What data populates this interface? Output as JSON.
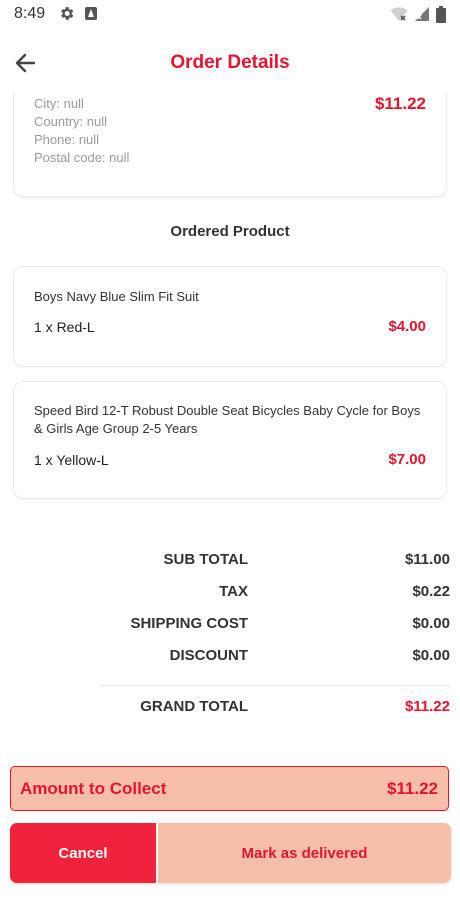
{
  "status_bar": {
    "time": "8:49",
    "icons": [
      "gear-icon",
      "a-icon",
      "wifi-icon",
      "signal-icon",
      "battery-icon"
    ]
  },
  "app_bar": {
    "title": "Order Details",
    "back_icon": "arrow-left-icon"
  },
  "address": {
    "lines": [
      "City: null",
      "Country: null",
      "Phone: null",
      "Postal code: null"
    ],
    "price": "$11.22"
  },
  "ordered_product": {
    "title": "Ordered Product",
    "items": [
      {
        "name": "Boys Navy Blue Slim Fit Suit",
        "qty_variant": "1 x Red-L",
        "price": "$4.00"
      },
      {
        "name": "Speed Bird 12-T Robust Double Seat Bicycles Baby Cycle for Boys & Girls Age Group 2-5 Years",
        "qty_variant": "1 x Yellow-L",
        "price": "$7.00"
      }
    ]
  },
  "summary": {
    "sub_total_label": "SUB TOTAL",
    "sub_total": "$11.00",
    "tax_label": "TAX",
    "tax": "$0.22",
    "shipping_label": "SHIPPING COST",
    "shipping": "$0.00",
    "discount_label": "DISCOUNT",
    "discount": "$0.00",
    "grand_total_label": "GRAND TOTAL",
    "grand_total": "$11.22"
  },
  "collect": {
    "label": "Amount to Collect",
    "value": "$11.22"
  },
  "actions": {
    "cancel": "Cancel",
    "mark_delivered": "Mark as delivered"
  },
  "colors": {
    "accent": "#e5142f",
    "cancel_bg": "#f0233a",
    "soft_bg": "#f7bfa8"
  }
}
